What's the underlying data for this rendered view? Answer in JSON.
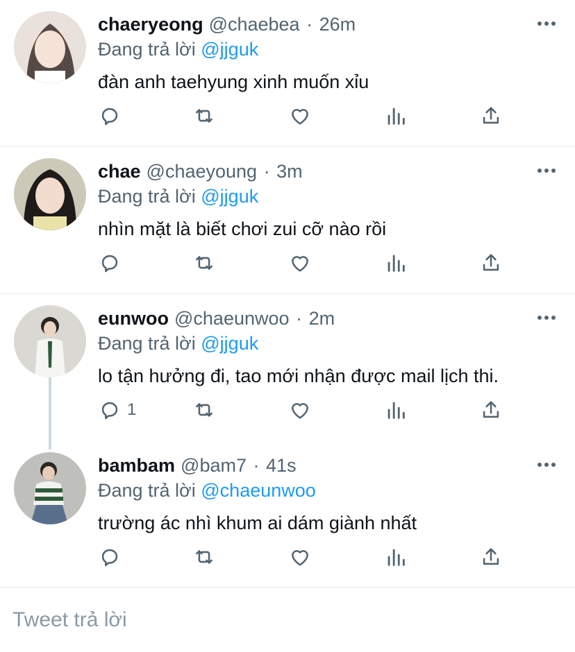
{
  "replies": [
    {
      "display_name": "chaeryeong",
      "handle": "@chaebea",
      "time": "26m",
      "replying_to_label": "Đang trả lời ",
      "replying_to_handle": "@jjguk",
      "text": "đàn anh taehyung xinh muốn xỉu",
      "reply_count": ""
    },
    {
      "display_name": "chae",
      "handle": "@chaeyoung",
      "time": "3m",
      "replying_to_label": "Đang trả lời ",
      "replying_to_handle": "@jjguk",
      "text": "nhìn mặt là biết chơi zui cỡ nào rồi",
      "reply_count": ""
    },
    {
      "display_name": "eunwoo",
      "handle": "@chaeunwoo",
      "time": "2m",
      "replying_to_label": "Đang trả lời ",
      "replying_to_handle": "@jjguk",
      "text": "lo tận hưởng đi, tao mới nhận được mail lịch thi.",
      "reply_count": "1"
    },
    {
      "display_name": "bambam",
      "handle": "@bam7",
      "time": "41s",
      "replying_to_label": "Đang trả lời ",
      "replying_to_handle": "@chaeunwoo",
      "text": "trường ác nhì khum ai dám giành nhất",
      "reply_count": ""
    }
  ],
  "separator": "·",
  "compose": {
    "placeholder": "Tweet trả lời"
  },
  "icons": {
    "reply": "reply-icon",
    "retweet": "retweet-icon",
    "like": "heart-icon",
    "stats": "analytics-icon",
    "share": "share-icon",
    "more": "more-dots-icon"
  },
  "colors": {
    "accent": "#1d9bf0",
    "secondary_text": "#536471",
    "primary_text": "#0f1419",
    "divider": "#eff3f4",
    "thread_line": "#cfd9de"
  }
}
